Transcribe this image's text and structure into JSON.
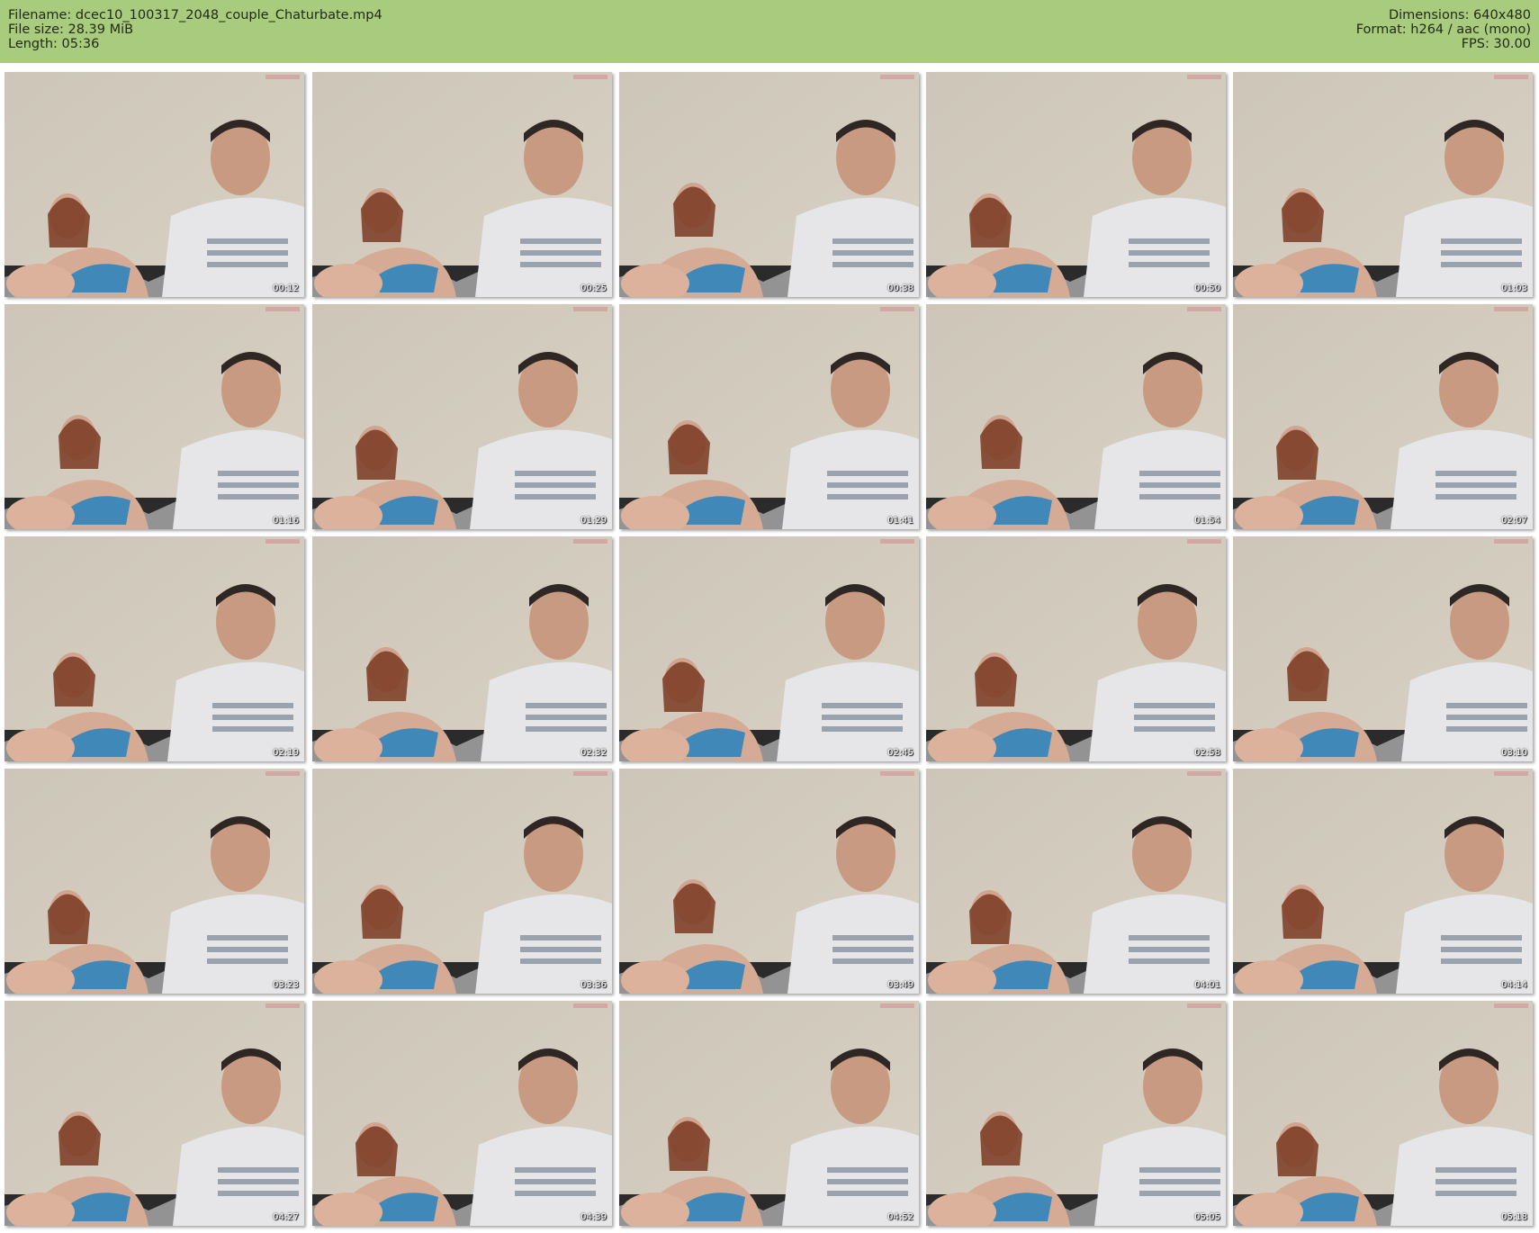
{
  "header": {
    "filename": "Filename: dcec10_100317_2048_couple_Chaturbate.mp4",
    "filesize": "File size: 28.39 MiB",
    "length": "Length: 05:36",
    "dimensions": "Dimensions: 640x480",
    "format": "Format: h264 / aac (mono)",
    "fps": "FPS: 30.00"
  },
  "thumbnails": [
    {
      "timestamp": "00:12"
    },
    {
      "timestamp": "00:25"
    },
    {
      "timestamp": "00:38"
    },
    {
      "timestamp": "00:50"
    },
    {
      "timestamp": "01:03"
    },
    {
      "timestamp": "01:16"
    },
    {
      "timestamp": "01:29"
    },
    {
      "timestamp": "01:41"
    },
    {
      "timestamp": "01:54"
    },
    {
      "timestamp": "02:07"
    },
    {
      "timestamp": "02:19"
    },
    {
      "timestamp": "02:32"
    },
    {
      "timestamp": "02:45"
    },
    {
      "timestamp": "02:58"
    },
    {
      "timestamp": "03:10"
    },
    {
      "timestamp": "03:23"
    },
    {
      "timestamp": "03:36"
    },
    {
      "timestamp": "03:49"
    },
    {
      "timestamp": "04:01"
    },
    {
      "timestamp": "04:14"
    },
    {
      "timestamp": "04:27"
    },
    {
      "timestamp": "04:39"
    },
    {
      "timestamp": "04:52"
    },
    {
      "timestamp": "05:05"
    },
    {
      "timestamp": "05:18"
    }
  ],
  "colors": {
    "header_bg": "#a9cb7e",
    "wall": "#d9d2c4",
    "top_wear": "#3f88b8"
  }
}
